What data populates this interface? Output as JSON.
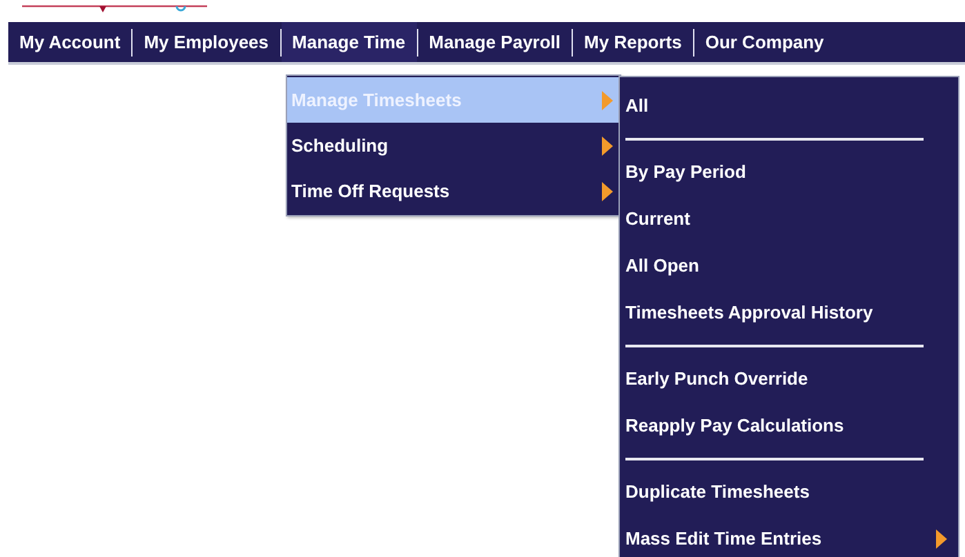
{
  "nav": [
    {
      "label": "My Account",
      "selected": false
    },
    {
      "label": "My Employees",
      "selected": false
    },
    {
      "label": "Manage Time",
      "selected": true
    },
    {
      "label": "Manage Payroll",
      "selected": false
    },
    {
      "label": "My Reports",
      "selected": false
    },
    {
      "label": "Our Company",
      "selected": false
    }
  ],
  "submenu": [
    {
      "label": "Manage Timesheets",
      "selected": true,
      "has_submenu": true
    },
    {
      "label": "Scheduling",
      "selected": false,
      "has_submenu": true
    },
    {
      "label": "Time Off Requests",
      "selected": false,
      "has_submenu": true
    }
  ],
  "flyout": [
    {
      "kind": "item",
      "label": "All",
      "has_submenu": false
    },
    {
      "kind": "separator"
    },
    {
      "kind": "item",
      "label": "By Pay Period",
      "has_submenu": false
    },
    {
      "kind": "item",
      "label": "Current",
      "has_submenu": false
    },
    {
      "kind": "item",
      "label": "All Open",
      "has_submenu": false
    },
    {
      "kind": "item",
      "label": "Timesheets Approval History",
      "has_submenu": false
    },
    {
      "kind": "separator"
    },
    {
      "kind": "item",
      "label": "Early Punch Override",
      "has_submenu": false
    },
    {
      "kind": "item",
      "label": "Reapply Pay Calculations",
      "has_submenu": false
    },
    {
      "kind": "separator"
    },
    {
      "kind": "item",
      "label": "Duplicate Timesheets",
      "has_submenu": false
    },
    {
      "kind": "item",
      "label": "Mass Edit Time Entries",
      "has_submenu": true
    }
  ]
}
